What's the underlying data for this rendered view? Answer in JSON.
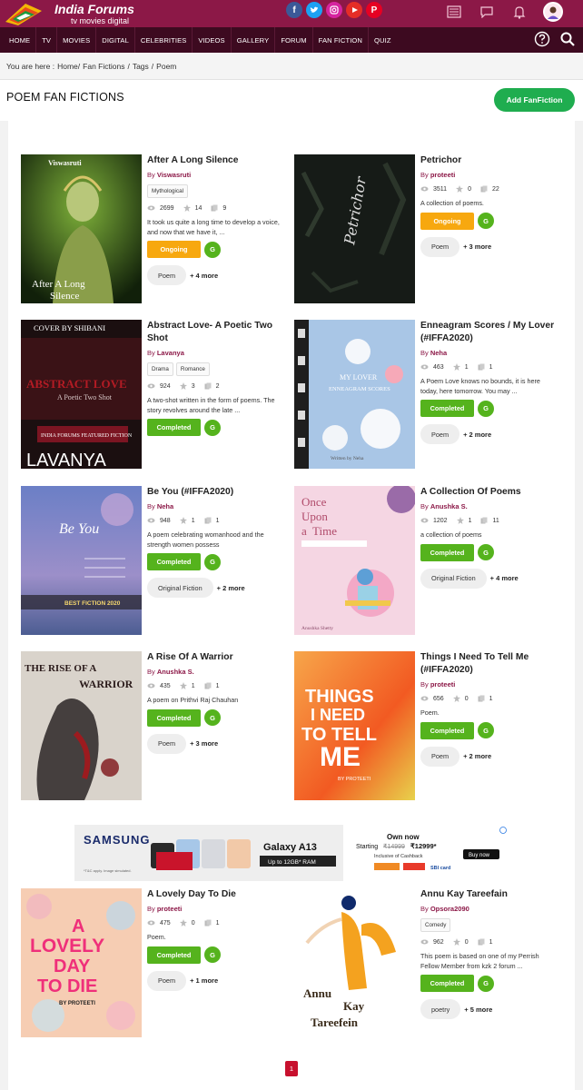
{
  "brand": {
    "title": "India Forums",
    "subtitle": "tv  movies  digital"
  },
  "colors": {
    "brand": "#8c1847",
    "nav_bg": "#3d0a20",
    "add_button": "#1fad4f",
    "ongoing": "#f7a80f",
    "completed": "#55b31d",
    "page_active": "#c8102e"
  },
  "nav": {
    "items": [
      "HOME",
      "TV",
      "MOVIES",
      "DIGITAL",
      "CELEBRITIES",
      "VIDEOS",
      "GALLERY",
      "FORUM",
      "FAN FICTION",
      "QUIZ"
    ]
  },
  "breadcrumb": {
    "prefix": "You are here :",
    "items": [
      "Home",
      "Fan Fictions",
      "Tags",
      "Poem"
    ]
  },
  "page": {
    "title": "POEM FAN FICTIONS",
    "add_button": "Add FanFiction"
  },
  "cards": [
    {
      "title": "After A Long Silence",
      "by": "By ",
      "author": "Viswasruti",
      "genres": [
        "Mythological"
      ],
      "views": "2699",
      "stars": "14",
      "chapters": "9",
      "desc": "It took us quite a long time to develop a voice, and now that we have it, ...",
      "status": "Ongoing",
      "rating": "G",
      "tag": "Poem",
      "more": "+ 4 more",
      "cover_title": "After A Long Silence",
      "cover_top": "Viswasruti"
    },
    {
      "title": "Petrichor",
      "by": "By ",
      "author": "proteeti",
      "genres": [],
      "views": "3511",
      "stars": "0",
      "chapters": "22",
      "desc": "A collection of poems.",
      "status": "Ongoing",
      "rating": "G",
      "tag": "Poem",
      "more": "+ 3 more",
      "cover_title": "Petrichor"
    },
    {
      "title": "Abstract Love- A Poetic Two Shot",
      "by": "By ",
      "author": "Lavanya",
      "genres": [
        "Drama",
        "Romance"
      ],
      "views": "924",
      "stars": "3",
      "chapters": "2",
      "desc": "A two-shot written in the form of poems. The story revolves around the late ...",
      "status": "Completed",
      "rating": "G",
      "tag": "",
      "more": "",
      "cover_top": "COVER BY SHIBANI",
      "cover_title": "ABSTRACT LOVE",
      "cover_sub": "A Poetic Two Shot",
      "cover_badge": "INDIA FORUMS FEATURED FICTION",
      "cover_author": "LAVANYA"
    },
    {
      "title": "Enneagram Scores / My Lover (#IFFA2020)",
      "by": "By ",
      "author": "Neha",
      "genres": [],
      "views": "463",
      "stars": "1",
      "chapters": "1",
      "desc": "A Poem Love knows no bounds, it is here today, here tomorrow. You may ...",
      "status": "Completed",
      "rating": "G",
      "tag": "Poem",
      "more": "+ 2 more",
      "cover_title": "MY LOVER",
      "cover_sub": "ENNEAGRAM SCORES",
      "cover_author": "Written by Neha"
    },
    {
      "title": "Be You (#IFFA2020)",
      "by": "By ",
      "author": "Neha",
      "genres": [],
      "views": "948",
      "stars": "1",
      "chapters": "1",
      "desc": "A poem celebrating womanhood and the strength women possess",
      "status": "Completed",
      "rating": "G",
      "tag": "Original Fiction",
      "more": "+ 2 more",
      "cover_title": "Be You",
      "cover_badge": "BEST FICTION 2020"
    },
    {
      "title": "A Collection Of Poems",
      "by": "By ",
      "author": "Anushka S.",
      "genres": [],
      "views": "1202",
      "stars": "1",
      "chapters": "11",
      "desc": "a collection of poems",
      "status": "Completed",
      "rating": "G",
      "tag": "Original Fiction",
      "more": "+ 4 more",
      "cover_title_lines": [
        "Once",
        "Upon",
        "a",
        "Time"
      ],
      "cover_author": "Anushka Shetty"
    },
    {
      "title": "A Rise Of A Warrior",
      "by": "By ",
      "author": "Anushka S.",
      "genres": [],
      "views": "435",
      "stars": "1",
      "chapters": "1",
      "desc": "A poem on Prithvi Raj Chauhan",
      "status": "Completed",
      "rating": "G",
      "tag": "Poem",
      "more": "+ 3 more",
      "cover_title": "THE RISE OF A WARRIOR"
    },
    {
      "title": "Things I Need To Tell Me (#IFFA2020)",
      "by": "By ",
      "author": "proteeti",
      "genres": [],
      "views": "656",
      "stars": "0",
      "chapters": "1",
      "desc": "Poem.",
      "status": "Completed",
      "rating": "G",
      "tag": "Poem",
      "more": "+ 2 more",
      "cover_title_lines": [
        "THINGS",
        "I NEED",
        "TO TELL",
        "ME"
      ],
      "cover_author": "BY PROTEETI"
    },
    {
      "title": "A Lovely Day To Die",
      "by": "By ",
      "author": "proteeti",
      "genres": [],
      "views": "475",
      "stars": "0",
      "chapters": "1",
      "desc": "Poem.",
      "status": "Completed",
      "rating": "G",
      "tag": "Poem",
      "more": "+ 1 more",
      "cover_title_lines": [
        "A",
        "LOVELY",
        "DAY",
        "TO DIE"
      ],
      "cover_author": "BY PROTEETI"
    },
    {
      "title": "Annu Kay Tareefain",
      "by": "By ",
      "author": "Opsora2090",
      "genres": [
        "Comedy"
      ],
      "views": "962",
      "stars": "0",
      "chapters": "1",
      "desc": "This poem is based on one of my Perrish Fellow Member from kzk 2 forum ...",
      "status": "Completed",
      "rating": "G",
      "tag": "poetry",
      "more": "+ 5 more",
      "cover_title_lines": [
        "Annu",
        "Kay",
        "Tareefein"
      ]
    }
  ],
  "ad": {
    "brand": "SAMSUNG",
    "product": "Galaxy A13",
    "spec": "Up to 12GB* RAM",
    "offer_title": "Own now",
    "offer_line": "Starting",
    "old_price": "₹14999",
    "new_price": "₹12999*",
    "cashback": "Inclusive of Cashback",
    "cta": "Buy now",
    "fine_print": "*T&C apply. Image simulated.",
    "bank": "SBI card"
  },
  "pagination": {
    "current": "1"
  }
}
